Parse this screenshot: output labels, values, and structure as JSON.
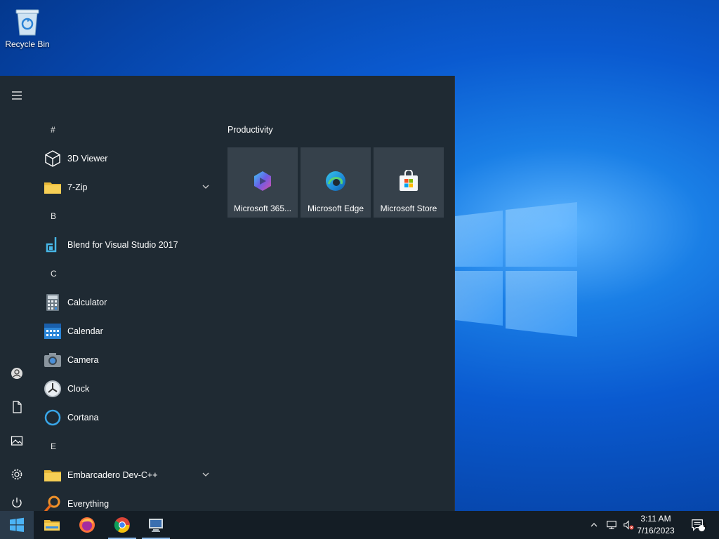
{
  "desktop": {
    "icons": [
      {
        "label": "Recycle Bin",
        "icon": "recycle-bin-icon"
      }
    ]
  },
  "start_menu": {
    "rail": [
      {
        "icon": "hamburger-menu-icon"
      },
      {
        "icon": "user-account-icon"
      },
      {
        "icon": "documents-icon"
      },
      {
        "icon": "pictures-icon"
      },
      {
        "icon": "settings-gear-icon"
      },
      {
        "icon": "power-icon"
      }
    ],
    "app_list": [
      {
        "type": "letter",
        "label": "#"
      },
      {
        "type": "app",
        "label": "3D Viewer",
        "icon": "3d-viewer-icon"
      },
      {
        "type": "app",
        "label": "7-Zip",
        "icon": "folder-icon",
        "expandable": true
      },
      {
        "type": "letter",
        "label": "B"
      },
      {
        "type": "app",
        "label": "Blend for Visual Studio 2017",
        "icon": "blend-icon"
      },
      {
        "type": "letter",
        "label": "C"
      },
      {
        "type": "app",
        "label": "Calculator",
        "icon": "calculator-icon"
      },
      {
        "type": "app",
        "label": "Calendar",
        "icon": "calendar-icon"
      },
      {
        "type": "app",
        "label": "Camera",
        "icon": "camera-icon"
      },
      {
        "type": "app",
        "label": "Clock",
        "icon": "clock-icon"
      },
      {
        "type": "app",
        "label": "Cortana",
        "icon": "cortana-icon"
      },
      {
        "type": "letter",
        "label": "E"
      },
      {
        "type": "app",
        "label": "Embarcadero Dev-C++",
        "icon": "folder-icon",
        "expandable": true
      },
      {
        "type": "app",
        "label": "Everything",
        "icon": "everything-search-icon"
      }
    ],
    "tile_group": {
      "title": "Productivity",
      "tiles": [
        {
          "label": "Microsoft 365...",
          "icon": "microsoft-365-icon"
        },
        {
          "label": "Microsoft Edge",
          "icon": "edge-icon"
        },
        {
          "label": "Microsoft Store",
          "icon": "store-icon"
        }
      ]
    }
  },
  "taskbar": {
    "pinned": [
      {
        "icon": "file-explorer-icon"
      },
      {
        "icon": "firefox-icon"
      },
      {
        "icon": "chrome-icon"
      },
      {
        "icon": "remote-desktop-icon"
      }
    ],
    "tray": {
      "time": "3:11 AM",
      "date": "7/16/2023",
      "notification_count": "1"
    }
  }
}
